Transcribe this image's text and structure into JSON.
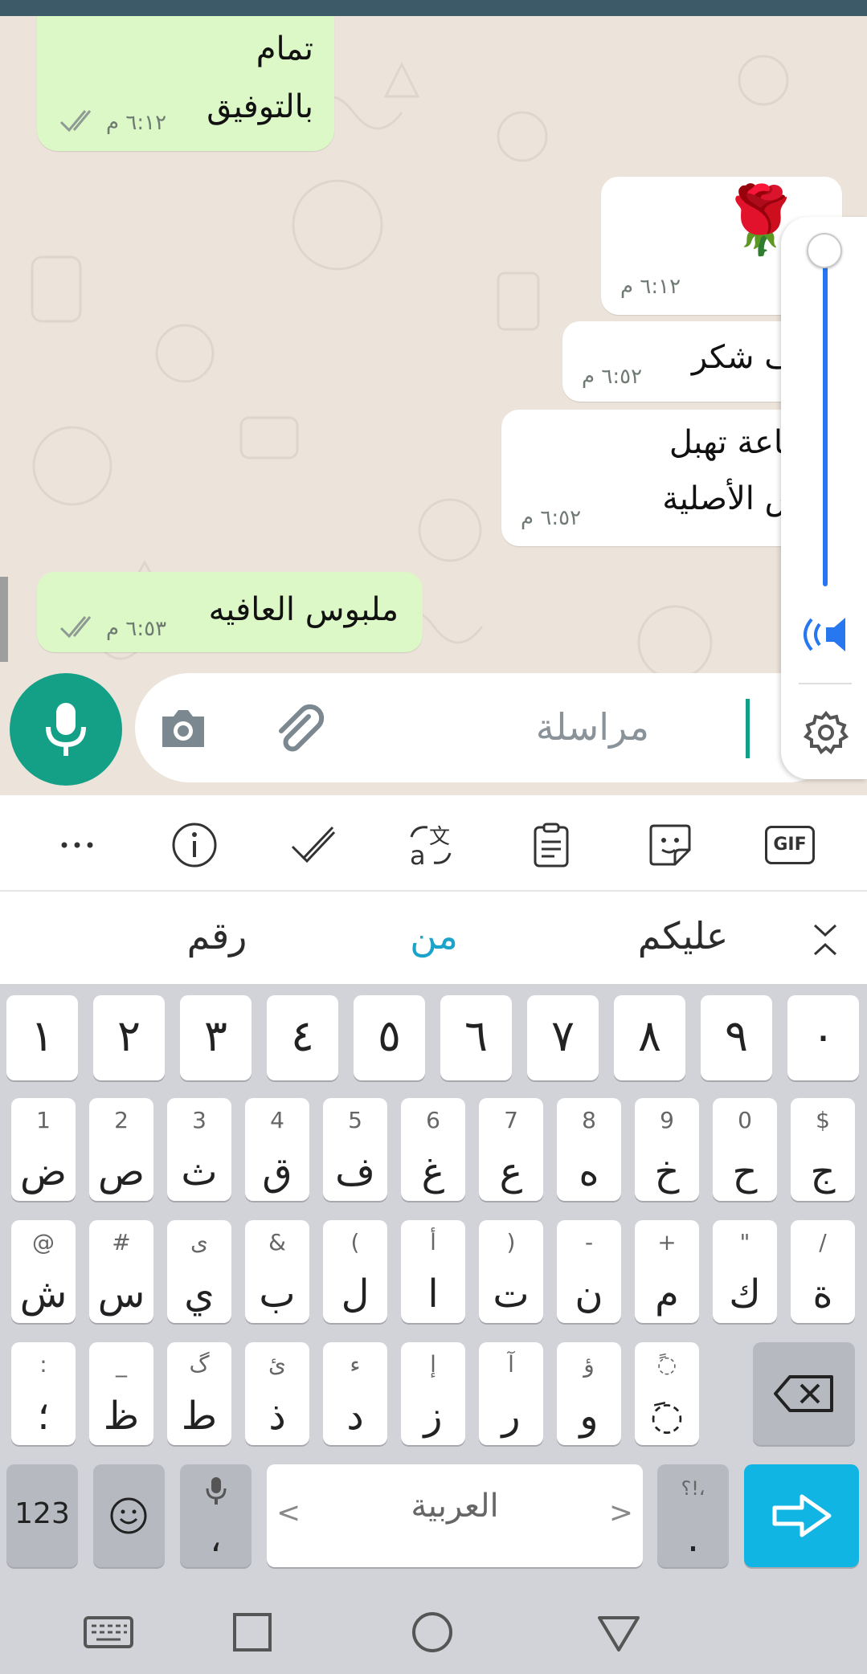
{
  "chat": {
    "messages": [
      {
        "direction": "outgoing",
        "lines": [
          "تمام",
          "بالتوفيق"
        ],
        "time": "٦:١٢ م",
        "read": true
      },
      {
        "direction": "incoming",
        "emoji": "🌹",
        "time": "٦:١٢ م"
      },
      {
        "direction": "incoming",
        "lines": [
          "ألف شكر"
        ],
        "time": "٦:٥٢ م"
      },
      {
        "direction": "incoming",
        "lines": [
          "الساعة تهبل",
          "نفس الأصلية"
        ],
        "time": "٦:٥٢ م"
      },
      {
        "direction": "outgoing",
        "lines": [
          "ملبوس العافيه"
        ],
        "time": "٦:٥٣ م",
        "read": true
      }
    ]
  },
  "composer": {
    "placeholder": "مراسلة",
    "mic_icon": "microphone-icon",
    "camera_icon": "camera-icon",
    "attach_icon": "paperclip-icon"
  },
  "volume": {
    "level": 1.0,
    "speaker_icon": "speaker-icon",
    "settings_icon": "gear-icon"
  },
  "keyboard": {
    "toolbar": [
      "more-icon",
      "info-icon",
      "check-icon",
      "translate-icon",
      "clipboard-icon",
      "sticker-icon",
      "gif-icon"
    ],
    "gif_label": "GIF",
    "suggestions": [
      "رقم",
      "من",
      "عليكم"
    ],
    "number_row": [
      "١",
      "٢",
      "٣",
      "٤",
      "٥",
      "٦",
      "٧",
      "٨",
      "٩",
      "٠"
    ],
    "row1": [
      {
        "main": "ض",
        "hint": "1"
      },
      {
        "main": "ص",
        "hint": "2"
      },
      {
        "main": "ث",
        "hint": "3"
      },
      {
        "main": "ق",
        "hint": "4"
      },
      {
        "main": "ف",
        "hint": "5"
      },
      {
        "main": "غ",
        "hint": "6"
      },
      {
        "main": "ع",
        "hint": "7"
      },
      {
        "main": "ه",
        "hint": "8"
      },
      {
        "main": "خ",
        "hint": "9"
      },
      {
        "main": "ح",
        "hint": "0"
      },
      {
        "main": "ج",
        "hint": "$"
      }
    ],
    "row2": [
      {
        "main": "ش",
        "hint": "@"
      },
      {
        "main": "س",
        "hint": "#"
      },
      {
        "main": "ي",
        "hint": "ى"
      },
      {
        "main": "ب",
        "hint": "&"
      },
      {
        "main": "ل",
        "hint": "("
      },
      {
        "main": "ا",
        "hint": "أ"
      },
      {
        "main": "ت",
        "hint": ")"
      },
      {
        "main": "ن",
        "hint": "-"
      },
      {
        "main": "م",
        "hint": "+"
      },
      {
        "main": "ك",
        "hint": "\""
      },
      {
        "main": "ة",
        "hint": "/"
      }
    ],
    "row3": [
      {
        "main": "؛",
        "hint": ":"
      },
      {
        "main": "ظ",
        "hint": "_"
      },
      {
        "main": "ط",
        "hint": "گ"
      },
      {
        "main": "ذ",
        "hint": "ئ"
      },
      {
        "main": "د",
        "hint": "ء"
      },
      {
        "main": "ز",
        "hint": "إ"
      },
      {
        "main": "ر",
        "hint": "آ"
      },
      {
        "main": "و",
        "hint": "ؤ"
      },
      {
        "main": "◌َ",
        "hint": "◌ً"
      }
    ],
    "sym_label": "123",
    "comma_label": "،",
    "space_label": "العربية",
    "period_label": ".",
    "period_hint": "؟!،",
    "left_arrow": "<",
    "right_arrow": ">"
  },
  "navbar": [
    "keyboard-icon",
    "recents-icon",
    "home-icon",
    "back-icon"
  ]
}
